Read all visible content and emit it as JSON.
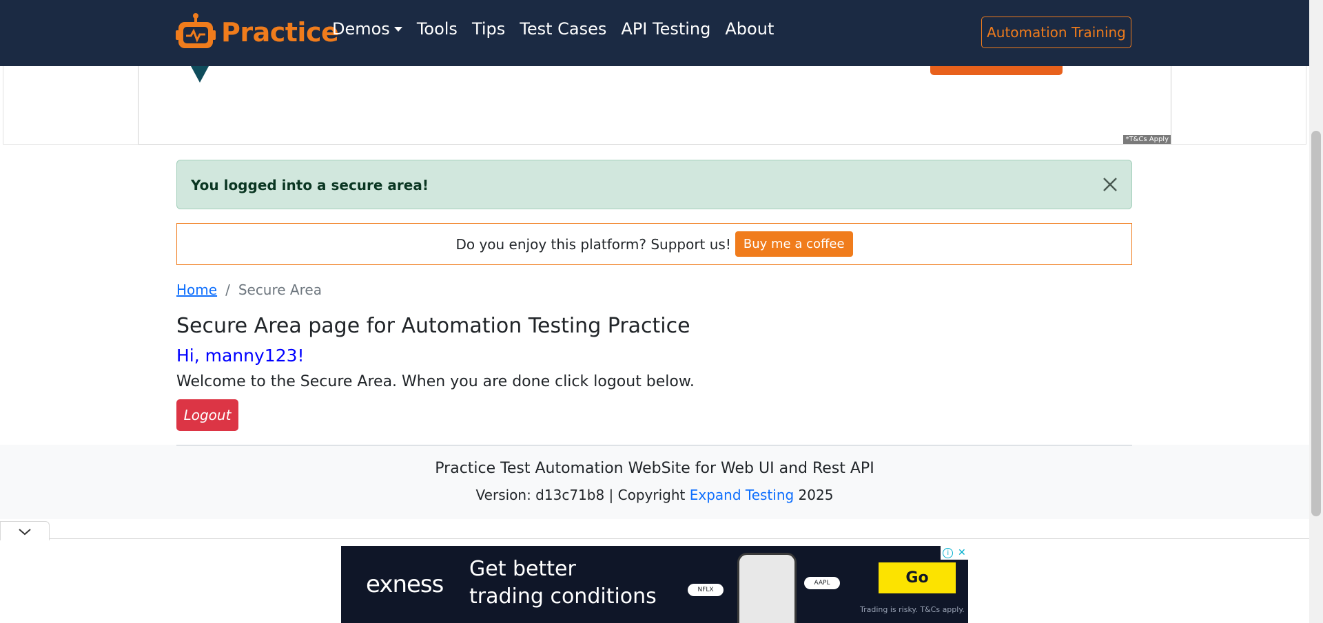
{
  "navbar": {
    "brand": "Practice",
    "items": [
      "Demos",
      "Tools",
      "Tips",
      "Test Cases",
      "API Testing",
      "About"
    ],
    "training_button": "Automation Training"
  },
  "top_ad": {
    "tcs": "*T&Cs Apply"
  },
  "alert": {
    "message": "You logged into a secure area!"
  },
  "support": {
    "text": "Do you enjoy this platform? Support us!",
    "button": "Buy me a coffee"
  },
  "breadcrumb": {
    "home": "Home",
    "separator": "/",
    "current": "Secure Area"
  },
  "content": {
    "title": "Secure Area page for Automation Testing Practice",
    "greeting": "Hi, manny123!",
    "welcome": "Welcome to the Secure Area. When you are done click logout below.",
    "logout_button": "Logout"
  },
  "footer": {
    "title": "Practice Test Automation WebSite for Web UI and Rest API",
    "version_prefix": "Version: d13c71b8 | Copyright ",
    "link": "Expand Testing",
    "year": " 2025"
  },
  "bottom_ad": {
    "brand": "exness",
    "headline_line1": "Get better",
    "headline_line2": "trading conditions",
    "chip1": "NFLX",
    "chip2": "AAPL",
    "go_button": "Go",
    "disclaimer": "Trading is risky. T&Cs apply."
  },
  "colors": {
    "navbar_bg": "#1b2a43",
    "brand_orange": "#f07c1c",
    "alert_bg": "#d1e7dd",
    "logout_red": "#dc3545",
    "link_blue": "#0d6efd"
  }
}
